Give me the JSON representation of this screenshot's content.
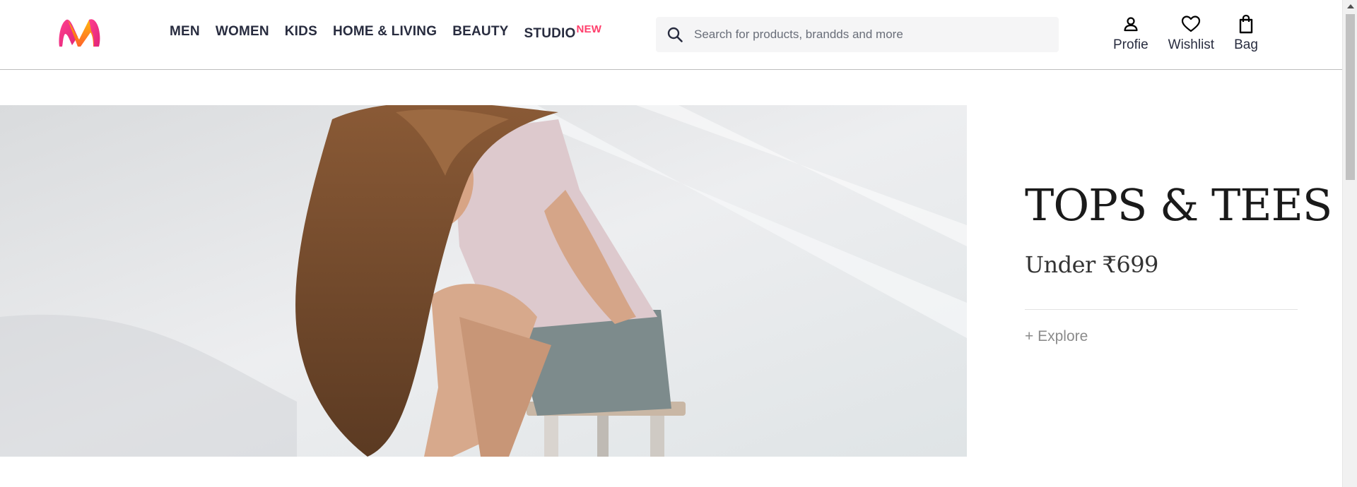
{
  "brand": {
    "logo_icon": "myntra-m-logo",
    "colors": {
      "accent": "#ff3f6c",
      "text": "#282c3f",
      "logo_pink": "#e0247a",
      "logo_orange": "#ff8a00"
    }
  },
  "nav": {
    "items": [
      {
        "label": "MEN"
      },
      {
        "label": "WOMEN"
      },
      {
        "label": "KIDS"
      },
      {
        "label": "HOME & LIVING"
      },
      {
        "label": "BEAUTY"
      },
      {
        "label": "STUDIO",
        "badge": "NEW"
      }
    ]
  },
  "search": {
    "placeholder": "Search for products, brandds and more",
    "icon": "search-icon"
  },
  "actions": [
    {
      "label": "Profie",
      "icon": "user-icon"
    },
    {
      "label": "Wishlist",
      "icon": "heart-icon"
    },
    {
      "label": "Bag",
      "icon": "bag-icon"
    }
  ],
  "hero": {
    "title": "TOPS & TEES",
    "subtitle": "Under ₹699",
    "cta": "+ Explore"
  }
}
